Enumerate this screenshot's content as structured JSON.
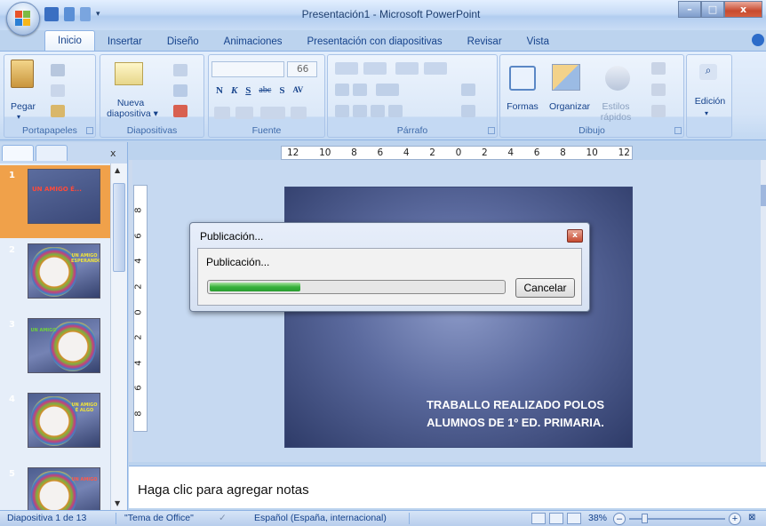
{
  "window": {
    "title": "Presentación1 - Microsoft PowerPoint",
    "minimize": "–",
    "maximize": "□",
    "close": "x"
  },
  "tabs": [
    {
      "label": "Inicio",
      "active": true
    },
    {
      "label": "Insertar"
    },
    {
      "label": "Diseño"
    },
    {
      "label": "Animaciones"
    },
    {
      "label": "Presentación con diapositivas"
    },
    {
      "label": "Revisar"
    },
    {
      "label": "Vista"
    }
  ],
  "ribbon": {
    "portapapeles": {
      "paste": "Pegar",
      "label": "Portapapeles"
    },
    "diapositivas": {
      "new_slide_line1": "Nueva",
      "new_slide_line2": "diapositiva ▾",
      "label": "Diapositivas"
    },
    "fuente": {
      "size": "66",
      "bold": "N",
      "italic": "K",
      "underline": "S",
      "strike": "abc",
      "shadow": "S",
      "spacing": "AV",
      "label": "Fuente"
    },
    "parrafo": {
      "label": "Párrafo"
    },
    "dibujo": {
      "shapes": "Formas",
      "arrange": "Organizar",
      "styles_line1": "Estilos",
      "styles_line2": "rápidos",
      "label": "Dibujo"
    },
    "edicion": {
      "label": "Edición"
    }
  },
  "hruler": [
    "12",
    "10",
    "8",
    "6",
    "4",
    "2",
    "0",
    "2",
    "4",
    "6",
    "8",
    "10",
    "12"
  ],
  "vruler": [
    "8",
    "6",
    "4",
    "2",
    "0",
    "2",
    "4",
    "6",
    "8"
  ],
  "slides": [
    {
      "num": "1",
      "text": "UN AMIGO É..."
    },
    {
      "num": "2",
      "text": "UN AMIGO ESPERANDO"
    },
    {
      "num": "3",
      "text": "UN AMIGO"
    },
    {
      "num": "4",
      "text": "UN AMIGO É ALGO"
    },
    {
      "num": "5",
      "text": "UN AMIGO"
    }
  ],
  "main_slide": {
    "line1": "TRABALLO REALIZADO POLOS",
    "line2": "ALUMNOS DE 1º ED. PRIMARIA.",
    "partial_title": "UN AMIGO É..."
  },
  "notes": {
    "placeholder": "Haga clic para agregar notas"
  },
  "status": {
    "slide": "Diapositiva 1 de 13",
    "theme": "\"Tema de Office\"",
    "language": "Español (España, internacional)",
    "zoom": "38%",
    "zoom_level": 0.38
  },
  "dialog": {
    "title": "Publicación...",
    "message": "Publicación...",
    "cancel": "Cancelar",
    "progress": 0.31
  },
  "colors": {
    "progress_green": "#36b13b",
    "selected_slide": "#f0a14a",
    "ribbon_text": "#15428b"
  }
}
